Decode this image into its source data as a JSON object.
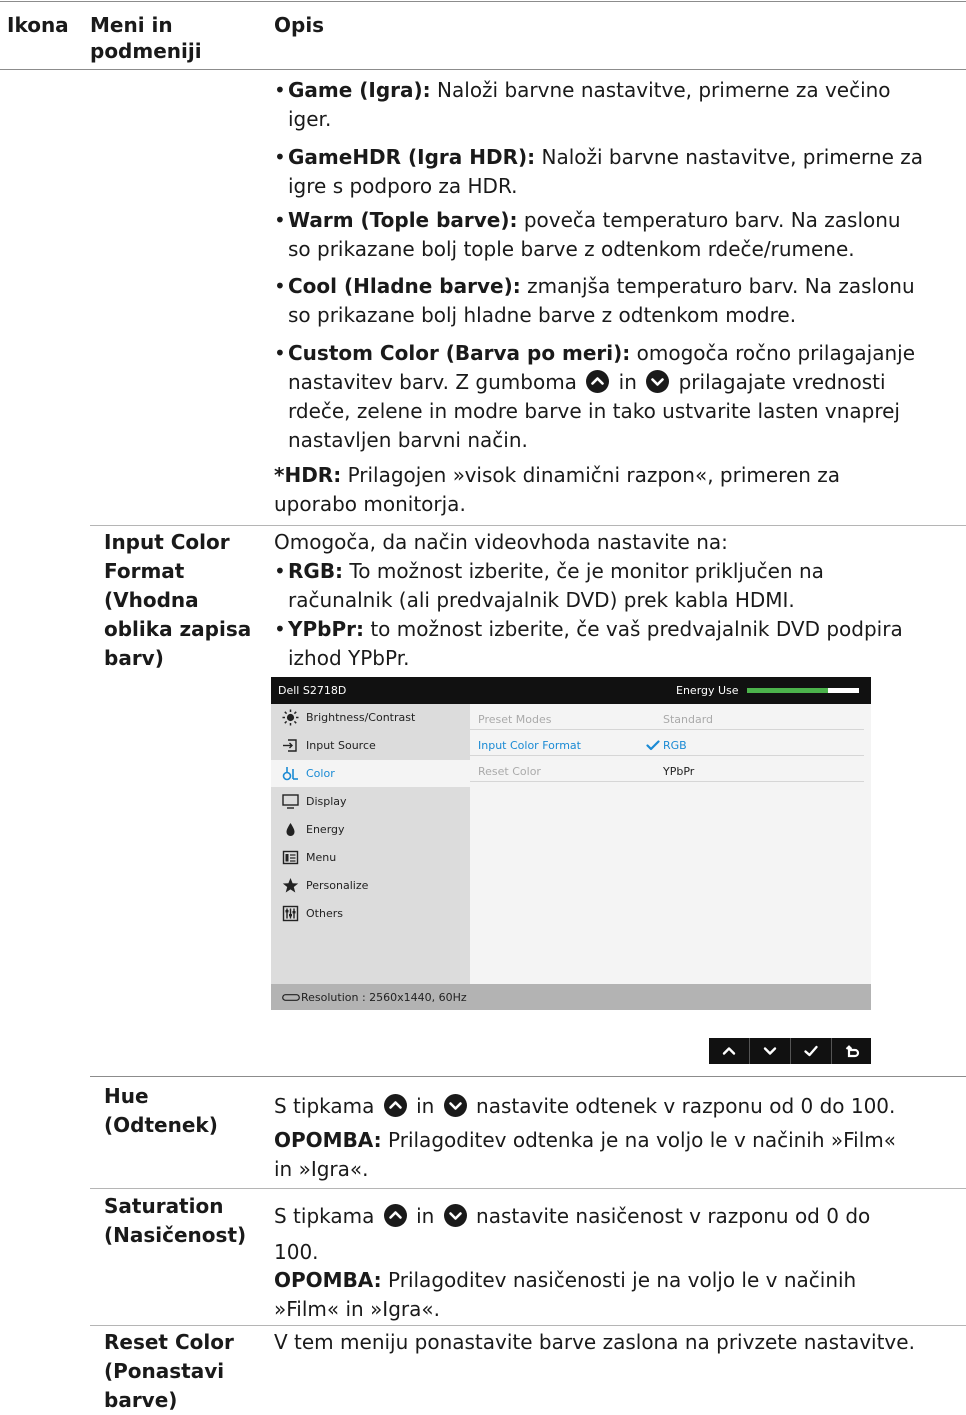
{
  "header": {
    "col_icon": "Ikona",
    "col_menu_line1": "Meni in",
    "col_menu_line2": "podmeniji",
    "col_desc": "Opis"
  },
  "preset_modes": [
    {
      "term": "Game (Igra):",
      "line1": "Naloži barvne nastavitve, primerne za večino",
      "line2": "iger."
    },
    {
      "term": "GameHDR (Igra HDR):",
      "line1": "Naloži barvne nastavitve, primerne za",
      "line2": "igre s podporo za HDR."
    },
    {
      "term": "Warm (Tople barve):",
      "line1": "poveča temperaturo barv. Na zaslonu",
      "line2": "so prikazane bolj tople barve z odtenkom rdeče/rumene."
    },
    {
      "term": "Cool (Hladne barve):",
      "line1": "zmanjša temperaturo barv. Na zaslonu",
      "line2": "so prikazane bolj hladne barve z odtenkom modre."
    }
  ],
  "custom_color": {
    "term": "Custom Color (Barva po meri):",
    "line1": "omogoča ročno prilagajanje",
    "line2_a": "nastavitev barv. Z gumboma",
    "line2_in": "in",
    "line2_b": "prilagajate vrednosti",
    "line3": "rdeče, zelene in modre barve in tako ustvarite lasten vnaprej",
    "line4": "nastavljen barvni način."
  },
  "hdr_note": {
    "term": "*HDR:",
    "line1": "Prilagojen »visok dinamični razpon«, primeren za",
    "line2": "uporabo monitorja."
  },
  "input_color_format": {
    "menu": [
      "Input Color",
      "Format",
      "(Vhodna",
      "oblika zapisa",
      "barv)"
    ],
    "intro": "Omogoča, da način videovhoda nastavite na:",
    "rgb_term": "RGB:",
    "rgb_line1": "To možnost izberite, če je monitor priključen na",
    "rgb_line2": "računalnik (ali predvajalnik DVD) prek kabla HDMI.",
    "ypbpr_term": "YPbPr:",
    "ypbpr_line1": "to možnost izberite, če vaš predvajalnik DVD podpira",
    "ypbpr_line2": "izhod YPbPr."
  },
  "osd": {
    "model": "Dell S2718D",
    "energy_label": "Energy Use",
    "energy_level": 0.72,
    "menu_items": [
      {
        "label": "Brightness/Contrast",
        "icon": "brightness-icon"
      },
      {
        "label": "Input Source",
        "icon": "input-source-icon"
      },
      {
        "label": "Color",
        "icon": "color-icon",
        "active": true
      },
      {
        "label": "Display",
        "icon": "display-icon"
      },
      {
        "label": "Energy",
        "icon": "energy-icon"
      },
      {
        "label": "Menu",
        "icon": "menu-icon"
      },
      {
        "label": "Personalize",
        "icon": "star-icon"
      },
      {
        "label": "Others",
        "icon": "others-icon"
      }
    ],
    "rows": [
      {
        "label": "Preset Modes",
        "value": "Standard"
      },
      {
        "label": "Input Color Format",
        "value": "RGB"
      },
      {
        "label": "Reset Color",
        "value": "YPbPr"
      }
    ],
    "resolution": "Resolution : 2560x1440, 60Hz",
    "accent": "#1a8ad4"
  },
  "hue": {
    "menu": [
      "Hue",
      "(Odtenek)"
    ],
    "line1_a": "S tipkama",
    "line1_in": "in",
    "line1_b": "nastavite odtenek v razponu od 0 do 100.",
    "note_term": "OPOMBA:",
    "note_line1": "Prilagoditev odtenka je na voljo le v načinih »Film«",
    "note_line2": "in »Igra«."
  },
  "saturation": {
    "menu": [
      "Saturation",
      "(Nasičenost)"
    ],
    "line1_a": "S tipkama",
    "line1_in": "in",
    "line1_b": "nastavite nasičenost v razponu od 0 do",
    "line2": "100.",
    "note_term": "OPOMBA:",
    "note_line1": "Prilagoditev nasičenosti je na voljo le v načinih",
    "note_line2": "»Film« in »Igra«."
  },
  "reset_color": {
    "menu": [
      "Reset Color",
      "(Ponastavi",
      "barve)"
    ],
    "desc": "V tem meniju ponastavite barve zaslona na privzete nastavitve."
  }
}
